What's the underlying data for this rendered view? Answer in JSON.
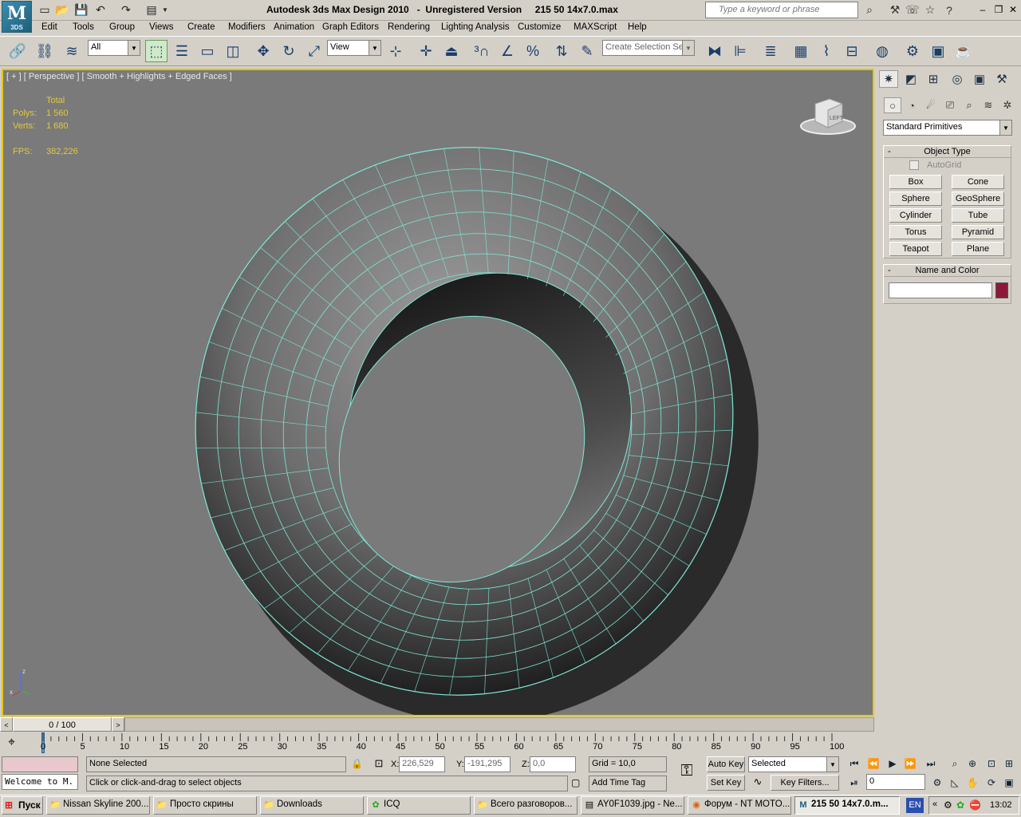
{
  "titlebar": {
    "title": "Autodesk 3ds Max Design 2010   -  Unregistered Version     215 50 14x7.0.max",
    "logo": "M",
    "logo_sub": "3DS",
    "search_placeholder": "Type a keyword or phrase"
  },
  "menu": [
    "Edit",
    "Tools",
    "Group",
    "Views",
    "Create",
    "Modifiers",
    "Animation",
    "Graph Editors",
    "Rendering",
    "Lighting Analysis",
    "Customize",
    "MAXScript",
    "Help"
  ],
  "toolbar": {
    "filter_value": "All",
    "ref_coord_value": "View",
    "selection_set_placeholder": "Create Selection Se"
  },
  "viewport": {
    "label": "[ + ] [ Perspective ] [ Smooth + Highlights + Edged Faces ]",
    "stats": {
      "total_label": "Total",
      "polys_label": "Polys:",
      "polys_value": "1 560",
      "verts_label": "Verts:",
      "verts_value": "1 680",
      "fps_label": "FPS:",
      "fps_value": "382,226"
    },
    "viewcube_label": "LEFT",
    "axis_z": "z",
    "axis_x": "x",
    "wire_color": "#7ee8d8",
    "bg_color": "#7a7a7a"
  },
  "command_panel": {
    "category_value": "Standard Primitives",
    "object_type": {
      "title": "Object Type",
      "autogrid_label": "AutoGrid",
      "buttons": [
        "Box",
        "Cone",
        "Sphere",
        "GeoSphere",
        "Cylinder",
        "Tube",
        "Torus",
        "Pyramid",
        "Teapot",
        "Plane"
      ]
    },
    "name_color": {
      "title": "Name and Color",
      "name_value": "",
      "color_swatch": "#8b1a3a"
    }
  },
  "timeline": {
    "slider_label": "0 / 100",
    "ticks": [
      "0",
      "5",
      "10",
      "15",
      "20",
      "25",
      "30",
      "35",
      "40",
      "45",
      "50",
      "55",
      "60",
      "65",
      "70",
      "75",
      "80",
      "85",
      "90",
      "95",
      "100"
    ]
  },
  "status": {
    "selection_text": "None Selected",
    "prompt_text": "Click or click-and-drag to select objects",
    "listener_text": "Welcome to M.",
    "x_label": "X:",
    "x_value": "226,529",
    "y_label": "Y:",
    "y_value": "-191,295",
    "z_label": "Z:",
    "z_value": "0,0",
    "grid_text": "Grid = 10,0",
    "add_time_tag": "Add Time Tag",
    "auto_key": "Auto Key",
    "set_key": "Set Key",
    "key_mode_value": "Selected",
    "key_filters": "Key Filters...",
    "frame_value": "0"
  },
  "taskbar": {
    "start_label": "Пуск",
    "tasks": [
      "Nissan Skyline 200...",
      "Просто скрины",
      "Downloads",
      "ICQ",
      "Всего разговоров...",
      "AY0F1039.jpg - Ne...",
      "Форум - NT MOTO...",
      "215 50 14x7.0.m..."
    ],
    "lang": "EN",
    "clock": "13:02"
  }
}
